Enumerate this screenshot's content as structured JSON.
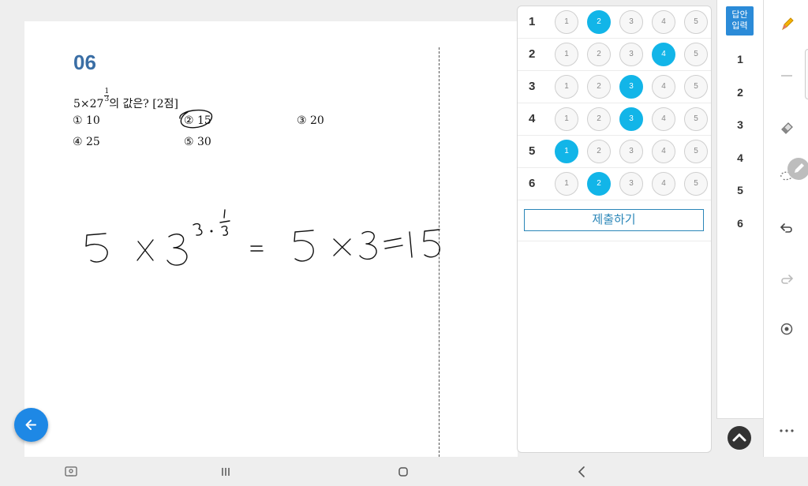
{
  "question": {
    "number": "06",
    "expr_base": "5×27",
    "exp_num": "1",
    "exp_den": "3",
    "text_suffix": "의 값은? [2점]",
    "choices": [
      "① 10",
      "② 15",
      "③ 20",
      "④ 25",
      "⑤ 30"
    ]
  },
  "handwriting": "5 × 3^(3·1/3) = 5 × 3 = 15",
  "answer_sheet": {
    "rows": [
      {
        "label": "1",
        "options": [
          "1",
          "2",
          "3",
          "4",
          "5"
        ],
        "selected": 2
      },
      {
        "label": "2",
        "options": [
          "1",
          "2",
          "3",
          "4",
          "5"
        ],
        "selected": 4
      },
      {
        "label": "3",
        "options": [
          "1",
          "2",
          "3",
          "4",
          "5"
        ],
        "selected": 3
      },
      {
        "label": "4",
        "options": [
          "1",
          "2",
          "3",
          "4",
          "5"
        ],
        "selected": 3
      },
      {
        "label": "5",
        "options": [
          "1",
          "2",
          "3",
          "4",
          "5"
        ],
        "selected": 1
      },
      {
        "label": "6",
        "options": [
          "1",
          "2",
          "3",
          "4",
          "5"
        ],
        "selected": 2
      }
    ],
    "submit_label": "제출하기"
  },
  "nav": {
    "answer_button_line1": "답안",
    "answer_button_line2": "입력",
    "numbers": [
      "1",
      "2",
      "3",
      "4",
      "5",
      "6"
    ]
  },
  "tools": [
    "pencil-icon",
    "line-icon",
    "eraser-icon",
    "lasso-icon",
    "undo-icon",
    "redo-icon",
    "record-icon",
    "more-icon"
  ],
  "colors": {
    "accent": "#12b5e8",
    "brand": "#2b8bd8",
    "title": "#3a6ea5"
  }
}
